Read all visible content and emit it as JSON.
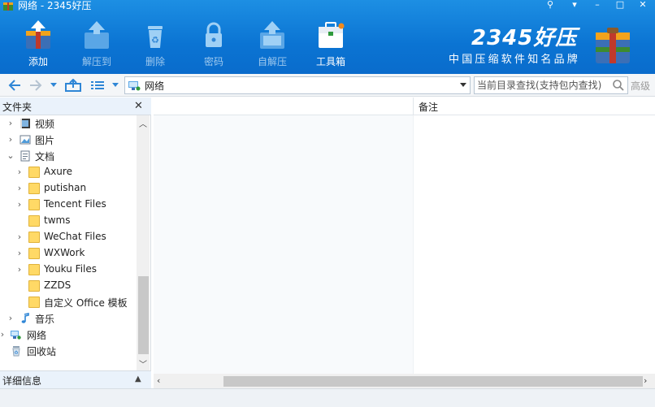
{
  "window": {
    "title": "网络 - 2345好压",
    "controls": {
      "menu": "▾",
      "minimize": "–",
      "maximize": "□",
      "close": "✕"
    }
  },
  "toolbar": {
    "items": [
      {
        "label": "添加",
        "icon": "add-archive-icon",
        "enabled": true
      },
      {
        "label": "解压到",
        "icon": "extract-icon",
        "enabled": false
      },
      {
        "label": "删除",
        "icon": "recycle-delete-icon",
        "enabled": false
      },
      {
        "label": "密码",
        "icon": "lock-icon",
        "enabled": false
      },
      {
        "label": "自解压",
        "icon": "self-extract-icon",
        "enabled": false
      },
      {
        "label": "工具箱",
        "icon": "toolbox-icon",
        "enabled": true
      }
    ]
  },
  "brand": {
    "logo": "2345好压",
    "slogan": "中国压缩软件知名品牌"
  },
  "address": {
    "path": "网络"
  },
  "search": {
    "placeholder": "当前目录查找(支持包内查找)",
    "advanced_label": "高级"
  },
  "folders_panel": {
    "title": "文件夹",
    "close": "✕",
    "tree": [
      {
        "label": "视频",
        "icon": "video-icon",
        "arrow": "›",
        "level": 1
      },
      {
        "label": "图片",
        "icon": "image-icon",
        "arrow": "›",
        "level": 1
      },
      {
        "label": "文档",
        "icon": "document-icon",
        "arrow": "⌄",
        "level": 1
      },
      {
        "label": "Axure",
        "icon": "folder-icon",
        "arrow": "›",
        "level": 2
      },
      {
        "label": "putishan",
        "icon": "folder-icon",
        "arrow": "›",
        "level": 2
      },
      {
        "label": "Tencent Files",
        "icon": "folder-icon",
        "arrow": "›",
        "level": 2
      },
      {
        "label": "twms",
        "icon": "folder-icon",
        "arrow": "",
        "level": 2
      },
      {
        "label": "WeChat Files",
        "icon": "folder-icon",
        "arrow": "›",
        "level": 2
      },
      {
        "label": "WXWork",
        "icon": "folder-icon",
        "arrow": "›",
        "level": 2
      },
      {
        "label": "Youku Files",
        "icon": "folder-icon",
        "arrow": "›",
        "level": 2
      },
      {
        "label": "ZZDS",
        "icon": "folder-icon",
        "arrow": "",
        "level": 2
      },
      {
        "label": "自定义 Office 模板",
        "icon": "folder-icon",
        "arrow": "",
        "level": 2
      },
      {
        "label": "音乐",
        "icon": "music-icon",
        "arrow": "›",
        "level": 1
      },
      {
        "label": "网络",
        "icon": "network-icon",
        "arrow": "›",
        "level": 0
      },
      {
        "label": "回收站",
        "icon": "recycle-bin-icon",
        "arrow": "",
        "level": 0
      }
    ]
  },
  "details_panel": {
    "title": "详细信息",
    "toggle": "▲"
  },
  "file_list": {
    "columns": [
      "",
      "备注"
    ]
  },
  "colors": {
    "header_blue": "#0b74d3",
    "panel_header": "#eaf2fb"
  }
}
